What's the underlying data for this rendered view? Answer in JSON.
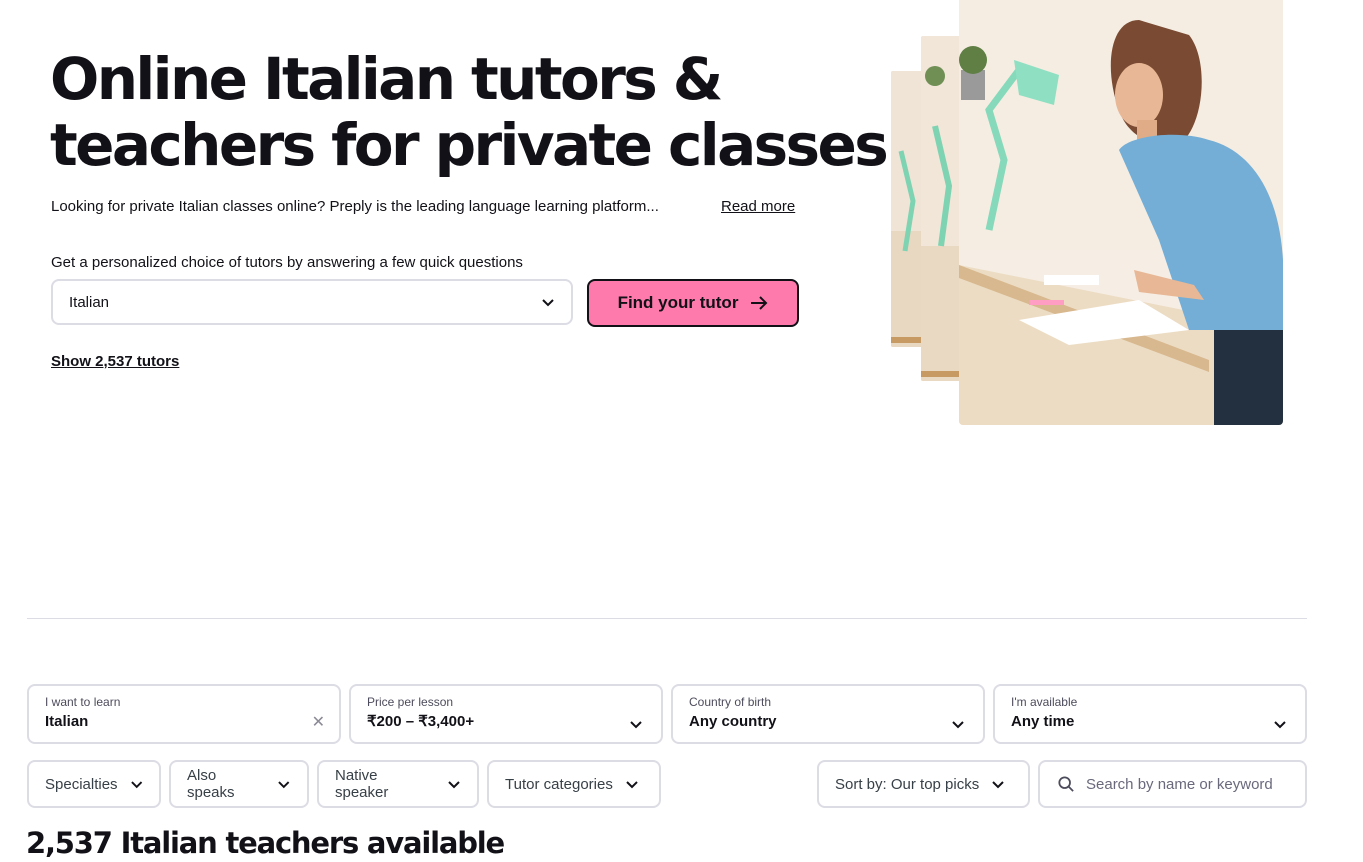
{
  "hero": {
    "title_line1": "Online Italian tutors &",
    "title_line2": "teachers for private classes",
    "description": "Looking for private Italian classes online? Preply is the leading language learning platform...",
    "read_more": "Read more",
    "quiz_label": "Get a personalized choice of tutors by answering a few quick questions",
    "language_value": "Italian",
    "find_button": "Find your tutor",
    "show_tutors": "Show 2,537 tutors"
  },
  "filters": {
    "learn": {
      "label": "I want to learn",
      "value": "Italian"
    },
    "price": {
      "label": "Price per lesson",
      "value": "₹200 – ₹3,400+"
    },
    "country": {
      "label": "Country of birth",
      "value": "Any country"
    },
    "available": {
      "label": "I'm available",
      "value": "Any time"
    },
    "pills": {
      "specialties": "Specialties",
      "also_speaks": "Also speaks",
      "native": "Native speaker",
      "categories": "Tutor categories"
    },
    "sort": "Sort by: Our top picks",
    "search_placeholder": "Search by name or keyword"
  },
  "results": {
    "title": "2,537 Italian teachers available"
  },
  "colors": {
    "accent": "#ff7aac",
    "text": "#121117",
    "border": "#dcdce5"
  },
  "icons": [
    "chevron-down-icon",
    "arrow-right-icon",
    "close-icon",
    "search-icon"
  ]
}
